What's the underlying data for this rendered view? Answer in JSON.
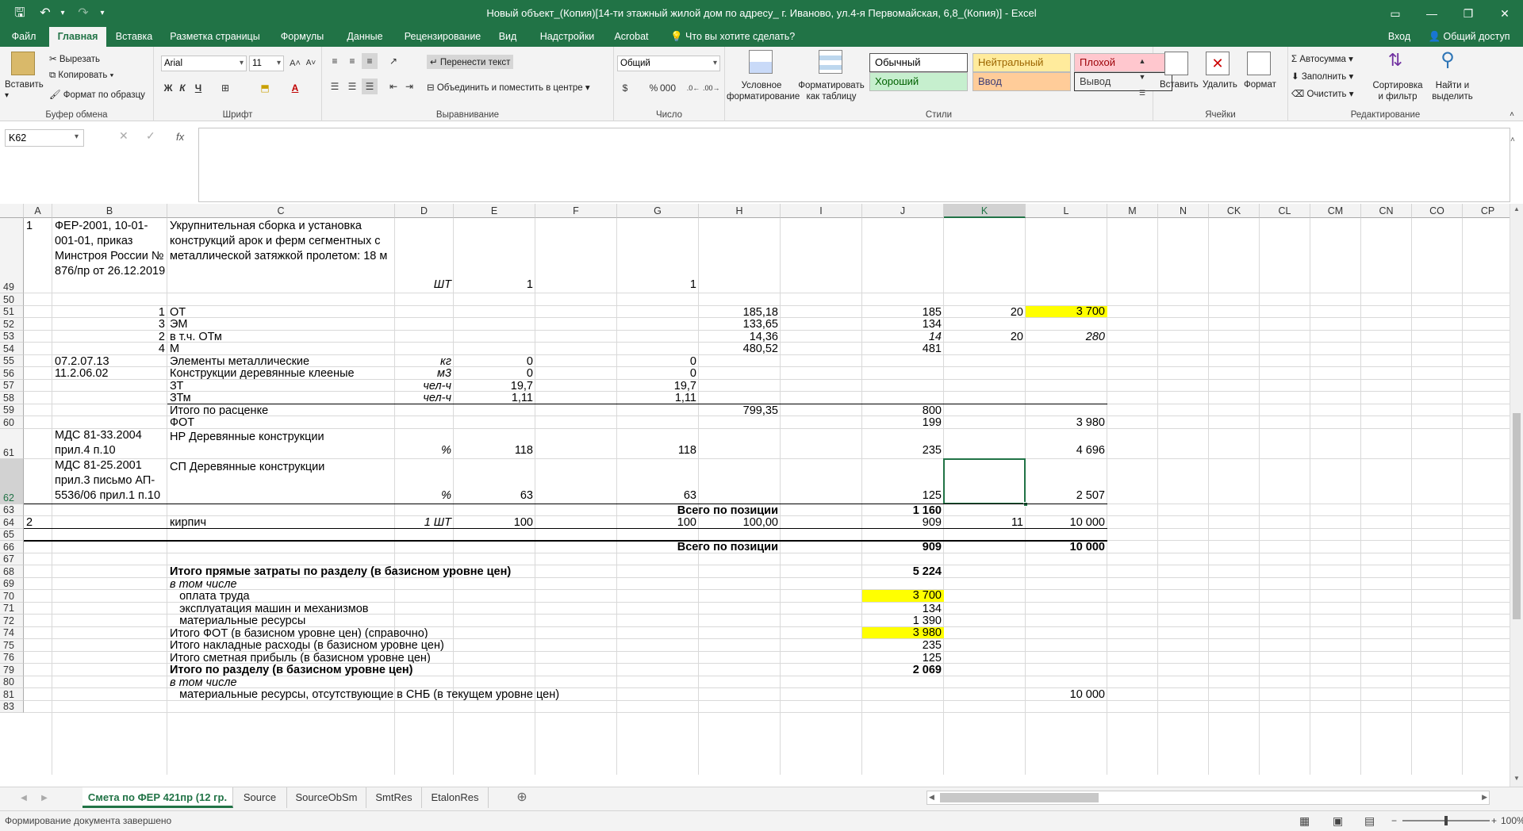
{
  "window": {
    "title": "Новый объект_(Копия)[14-ти этажный жилой дом по адресу_ г. Иваново, ул.4-я Первомайская, 6,8_(Копия)] - Excel"
  },
  "ribbon_tabs": [
    "Файл",
    "Главная",
    "Вставка",
    "Разметка страницы",
    "Формулы",
    "Данные",
    "Рецензирование",
    "Вид",
    "Надстройки",
    "Acrobat"
  ],
  "tell_me": "Что вы хотите сделать?",
  "account": {
    "login": "Вход",
    "share": "Общий доступ"
  },
  "clipboard": {
    "paste": "Вставить",
    "cut": "Вырезать",
    "copy": "Копировать",
    "format_painter": "Формат по образцу",
    "label": "Буфер обмена"
  },
  "font": {
    "name": "Arial",
    "size": "11",
    "bold": "Ж",
    "italic": "К",
    "underline": "Ч",
    "label": "Шрифт"
  },
  "alignment": {
    "wrap": "Перенести текст",
    "merge": "Объединить и поместить в центре",
    "label": "Выравнивание"
  },
  "number": {
    "format": "Общий",
    "label": "Число"
  },
  "styles": {
    "conditional": "Условное форматирование",
    "as_table": "Форматировать как таблицу",
    "label": "Стили",
    "items": [
      {
        "name": "Обычный",
        "bg": "#ffffff",
        "fg": "#000000"
      },
      {
        "name": "Нейтральный",
        "bg": "#ffeb9c",
        "fg": "#9c6500"
      },
      {
        "name": "Плохой",
        "bg": "#ffc7ce",
        "fg": "#9c0006"
      },
      {
        "name": "Хороший",
        "bg": "#c6efce",
        "fg": "#006100"
      },
      {
        "name": "Ввод",
        "bg": "#ffcc99",
        "fg": "#3f3f76"
      },
      {
        "name": "Вывод",
        "bg": "#f2f2f2",
        "fg": "#3f3f3f"
      }
    ]
  },
  "cells_group": {
    "insert": "Вставить",
    "delete": "Удалить",
    "format": "Формат",
    "label": "Ячейки"
  },
  "editing": {
    "autosum": "Автосумма",
    "fill": "Заполнить",
    "clear": "Очистить",
    "sort": "Сортировка и фильтр",
    "find": "Найти и выделить",
    "label": "Редактирование"
  },
  "name_box": "K62",
  "columns": [
    "A",
    "B",
    "C",
    "D",
    "E",
    "F",
    "G",
    "H",
    "I",
    "J",
    "K",
    "L",
    "M",
    "N",
    "CK",
    "CL",
    "CM",
    "CN",
    "CO",
    "CP"
  ],
  "selected_column": "K",
  "rows": [
    {
      "num": "49",
      "cells": {
        "A": "1",
        "B": "ФЕР-2001, 10-01-\n001-01, приказ\nМинстроя России №\n876/пр от 26.12.2019",
        "C": "Укрупнительная сборка и установка\nконструкций арок и ферм сегментных с\nметаллической затяжкой пролетом: 18 м",
        "D": "ШТ",
        "E": "1",
        "G": "1"
      }
    },
    {
      "num": "50",
      "cells": {}
    },
    {
      "num": "51",
      "cells": {
        "B": "1",
        "C": "ОТ",
        "H": "185,18",
        "J": "185",
        "K": "20",
        "L": "3 700"
      }
    },
    {
      "num": "52",
      "cells": {
        "B": "3",
        "C": "ЭМ",
        "H": "133,65",
        "J": "134"
      }
    },
    {
      "num": "53",
      "cells": {
        "B": "2",
        "C": "в т.ч. ОТм",
        "H": "14,36",
        "J": "14",
        "K": "20",
        "L": "280"
      }
    },
    {
      "num": "54",
      "cells": {
        "B": "4",
        "C": "М",
        "H": "480,52",
        "J": "481"
      }
    },
    {
      "num": "55",
      "cells": {
        "B": "07.2.07.13",
        "C": "Элементы металлические",
        "D": "кг",
        "E": "0",
        "G": "0"
      }
    },
    {
      "num": "56",
      "cells": {
        "B": "11.2.06.02",
        "C": "Конструкции деревянные клееные",
        "D": "м3",
        "E": "0",
        "G": "0"
      }
    },
    {
      "num": "57",
      "cells": {
        "C": "ЗТ",
        "D": "чел-ч",
        "E": "19,7",
        "G": "19,7"
      }
    },
    {
      "num": "58",
      "cells": {
        "C": "ЗТм",
        "D": "чел-ч",
        "E": "1,11",
        "G": "1,11"
      }
    },
    {
      "num": "59",
      "cells": {
        "C": "Итого по расценке",
        "H": "799,35",
        "J": "800"
      }
    },
    {
      "num": "60",
      "cells": {
        "C": "ФОТ",
        "J": "199",
        "L": "3 980"
      }
    },
    {
      "num": "61",
      "cells": {
        "B": "МДС 81-33.2004\nприл.4 п.10",
        "C": "НР Деревянные конструкции",
        "D": "%",
        "E": "118",
        "G": "118",
        "J": "235",
        "L": "4 696"
      }
    },
    {
      "num": "62",
      "cells": {
        "B": "МДС 81-25.2001\nприл.3 письмо АП-\n5536/06 прил.1 п.10",
        "C": "СП Деревянные конструкции",
        "D": "%",
        "E": "63",
        "G": "63",
        "J": "125",
        "L": "2 507"
      }
    },
    {
      "num": "63",
      "cells": {
        "H": "Всего по позиции",
        "J": "1 160"
      }
    },
    {
      "num": "64",
      "cells": {
        "A": "2",
        "C": "кирпич",
        "D": "1 ШТ",
        "E": "100",
        "G": "100",
        "H": "100,00",
        "J": "909",
        "K": "11",
        "L": "10 000"
      }
    },
    {
      "num": "65",
      "cells": {}
    },
    {
      "num": "66",
      "cells": {
        "H": "Всего по позиции",
        "J": "909",
        "L": "10 000"
      }
    },
    {
      "num": "67",
      "cells": {}
    },
    {
      "num": "68",
      "cells": {
        "C": "Итого прямые затраты по разделу (в базисном уровне цен)",
        "J": "5 224"
      }
    },
    {
      "num": "69",
      "cells": {
        "C": "в том числе"
      }
    },
    {
      "num": "70",
      "cells": {
        "C": "   оплата труда",
        "J": "3 700"
      }
    },
    {
      "num": "71",
      "cells": {
        "C": "   эксплуатация машин и механизмов",
        "J": "134"
      }
    },
    {
      "num": "72",
      "cells": {
        "C": "   материальные ресурсы",
        "J": "1 390"
      }
    },
    {
      "num": "74",
      "cells": {
        "C": "Итого ФОТ (в базисном уровне цен) (справочно)",
        "J": "3 980"
      }
    },
    {
      "num": "75",
      "cells": {
        "C": "Итого накладные расходы (в базисном уровне цен)",
        "J": "235"
      }
    },
    {
      "num": "76",
      "cells": {
        "C": "Итого сметная прибыль (в базисном уровне цен)",
        "J": "125"
      }
    },
    {
      "num": "79",
      "cells": {
        "C": "Итого по разделу (в базисном уровне цен)",
        "J": "2 069"
      }
    },
    {
      "num": "80",
      "cells": {
        "C": "в том числе"
      }
    },
    {
      "num": "81",
      "cells": {
        "C": "   материальные ресурсы, отсутствующие в СНБ (в текущем уровне цен)",
        "L": "10 000"
      }
    },
    {
      "num": "83",
      "cells": {}
    }
  ],
  "highlight_color": "#ffff00",
  "sheets": [
    "Смета по ФЕР 421пр (12 гр.",
    "Source",
    "SourceObSm",
    "SmtRes",
    "EtalonRes"
  ],
  "status": {
    "text": "Формирование документа завершено",
    "zoom": "100%"
  }
}
